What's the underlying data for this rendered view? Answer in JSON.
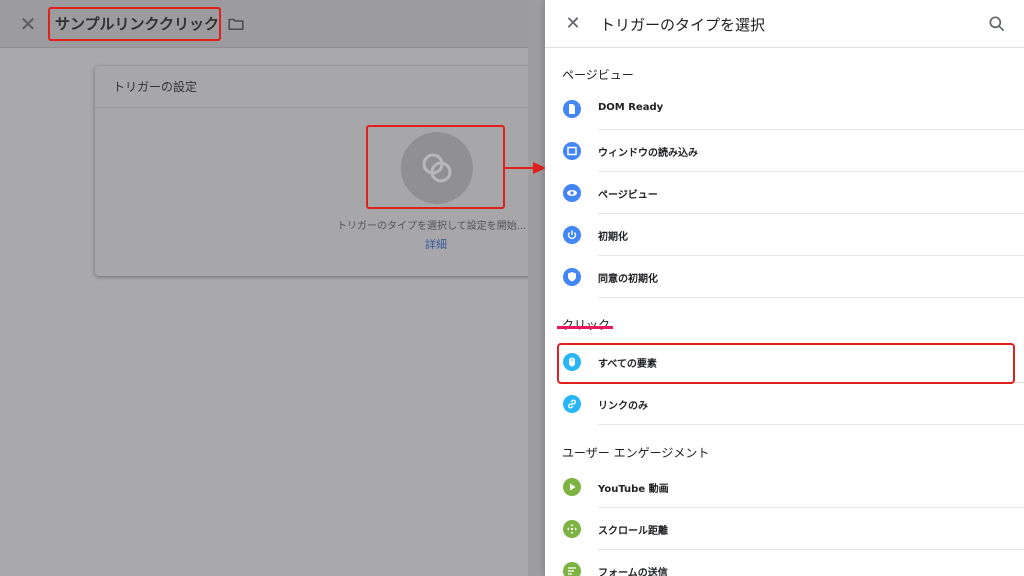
{
  "editor": {
    "title": "サンプルリンククリック",
    "card_title": "トリガーの設定",
    "card_description": "トリガーのタイプを選択して設定を開始...",
    "card_link": "詳細"
  },
  "drawer": {
    "title": "トリガーのタイプを選択",
    "sections": [
      {
        "title": "ページビュー",
        "items": [
          {
            "label": "DOM Ready",
            "icon": "document-icon",
            "color": "#4285f4"
          },
          {
            "label": "ウィンドウの読み込み",
            "icon": "window-icon",
            "color": "#4285f4"
          },
          {
            "label": "ページビュー",
            "icon": "eye-icon",
            "color": "#4285f4"
          },
          {
            "label": "初期化",
            "icon": "power-icon",
            "color": "#4285f4"
          },
          {
            "label": "同意の初期化",
            "icon": "shield-icon",
            "color": "#4285f4"
          }
        ]
      },
      {
        "title": "クリック",
        "items": [
          {
            "label": "すべての要素",
            "icon": "mouse-icon",
            "color": "#29b6f6"
          },
          {
            "label": "リンクのみ",
            "icon": "link-icon",
            "color": "#29b6f6"
          }
        ]
      },
      {
        "title": "ユーザー エンゲージメント",
        "items": [
          {
            "label": "YouTube 動画",
            "icon": "play-icon",
            "color": "#7cb342"
          },
          {
            "label": "スクロール距離",
            "icon": "move-icon",
            "color": "#7cb342"
          },
          {
            "label": "フォームの送信",
            "icon": "form-icon",
            "color": "#7cb342"
          }
        ]
      }
    ]
  },
  "colors": {
    "highlight": "#e0201c",
    "section_underline": "#e6195a"
  }
}
